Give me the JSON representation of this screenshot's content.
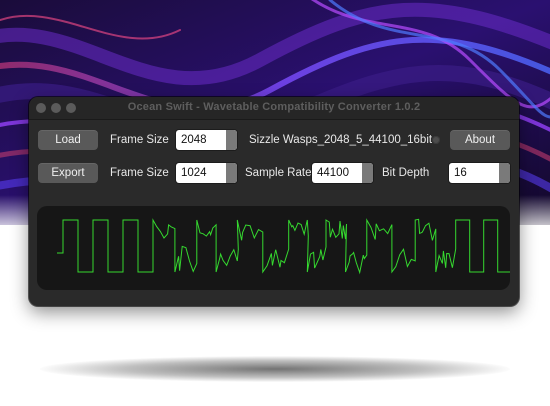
{
  "window": {
    "title": "Ocean Swift - Wavetable Compatibility Converter 1.0.2"
  },
  "row1": {
    "load_label": "Load",
    "frame_size_label": "Frame Size",
    "frame_size_value": "2048",
    "file_name": "Sizzle Wasps_2048_5_44100_16bit",
    "about_label": "About"
  },
  "row2": {
    "export_label": "Export",
    "frame_size_label": "Frame Size",
    "frame_size_value": "1024",
    "sample_rate_label": "Sample Rate",
    "sample_rate_value": "44100",
    "bit_depth_label": "Bit Depth",
    "bit_depth_value": "16"
  },
  "waveform": {
    "color": "#35d82f",
    "background": "#161616"
  },
  "colors": {
    "window_bg": "#2a2a2a",
    "button_bg": "#595959"
  }
}
